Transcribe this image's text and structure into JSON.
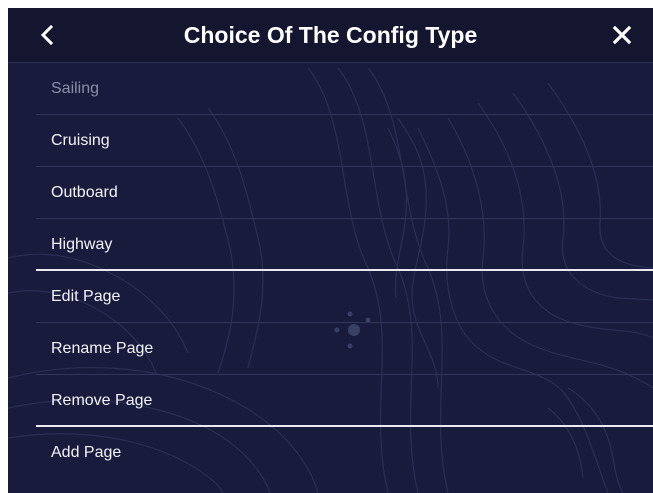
{
  "header": {
    "title": "Choice Of The Config Type",
    "back_icon": "chevron-left-icon",
    "close_icon": "close-icon"
  },
  "menu": {
    "items": [
      {
        "label": "Sailing",
        "state": "disabled"
      },
      {
        "label": "Cruising",
        "state": "enabled"
      },
      {
        "label": "Outboard",
        "state": "enabled"
      },
      {
        "label": "Highway",
        "state": "enabled"
      },
      {
        "label": "Edit Page",
        "state": "enabled"
      },
      {
        "label": "Rename Page",
        "state": "enabled"
      },
      {
        "label": "Remove Page",
        "state": "enabled"
      },
      {
        "label": "Add Page",
        "state": "enabled"
      }
    ]
  },
  "colors": {
    "background": "#181b3b",
    "header": "#14162f",
    "text": "#f2f3f8",
    "disabled_text": "#8a8ca8",
    "divider": "#e8e9f1"
  }
}
